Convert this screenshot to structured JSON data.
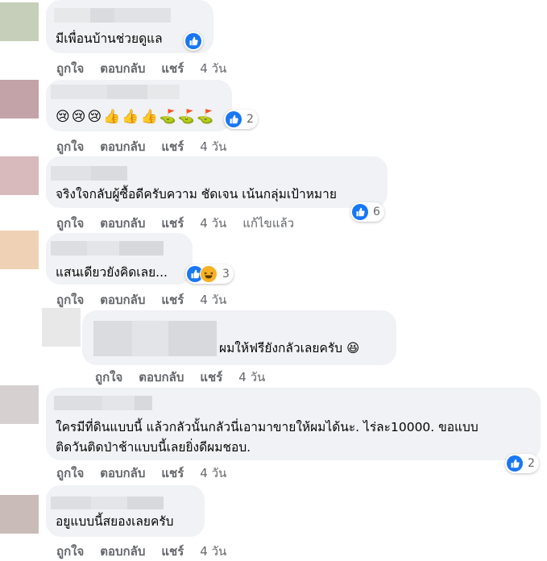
{
  "actions": {
    "like": "ถูกใจ",
    "reply": "ตอบกลับ",
    "share": "แชร์"
  },
  "comments": [
    {
      "text": "มีเพื่อนบ้านช่วยดูแล",
      "time": "4 วัน",
      "reaction_count": "",
      "reactions": [
        "like"
      ],
      "avatar_color": "#c6cfb9"
    },
    {
      "text": "😢😢😢👍👍👍⛳⛳⛳",
      "time": "4 วัน",
      "reaction_count": "2",
      "reactions": [
        "like"
      ],
      "avatar_color": "#c3a3a7"
    },
    {
      "text": "จริงใจกลับผู้ซื้อดีครับความ ชัดเจน เน้นกลุ่มเป้าหมาย",
      "time": "4 วัน",
      "edited": "แก้ไขแล้ว",
      "reaction_count": "6",
      "reactions": [
        "like"
      ],
      "avatar_color": "#d8b9bc"
    },
    {
      "text": "แสนเดียวยังคิดเลย...",
      "time": "4 วัน",
      "reaction_count": "3",
      "reactions": [
        "like",
        "haha"
      ],
      "avatar_color": "#efd2b6"
    },
    {
      "text": "ผมให้ฟรียังกลัวเลยครับ 😆",
      "time": "4 วัน",
      "reaction_count": "",
      "reactions": [],
      "avatar_color": "#e8e8e8"
    },
    {
      "text_lines": [
        "ใครมีที่ดินแบบนี้ แล้วกลัวนั้นกลัวนี่เอามาขายให้ผมได้นะ. ไร่ละ10000. ขอแบบ",
        "ติดวันติดป่าช้าแบบนี้เลยยิ่งดีผมชอบ."
      ],
      "time": "4 วัน",
      "reaction_count": "2",
      "reactions": [
        "like"
      ],
      "avatar_color": "#d6d0d1"
    },
    {
      "text": "อยูแบบนี้สยองเลยครับ",
      "time": "4 วัน",
      "reaction_count": "",
      "reactions": [],
      "avatar_color": "#c9bcb8"
    }
  ]
}
